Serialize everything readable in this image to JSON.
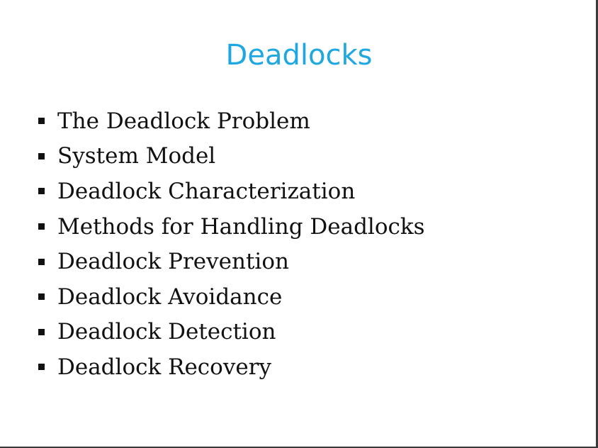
{
  "slide": {
    "title": "Deadlocks",
    "title_color": "#1ea7e1",
    "bullets": [
      "The Deadlock Problem",
      "System Model",
      "Deadlock Characterization",
      "Methods for Handling Deadlocks",
      "Deadlock Prevention",
      "Deadlock Avoidance",
      "Deadlock Detection",
      "Deadlock Recovery"
    ]
  }
}
